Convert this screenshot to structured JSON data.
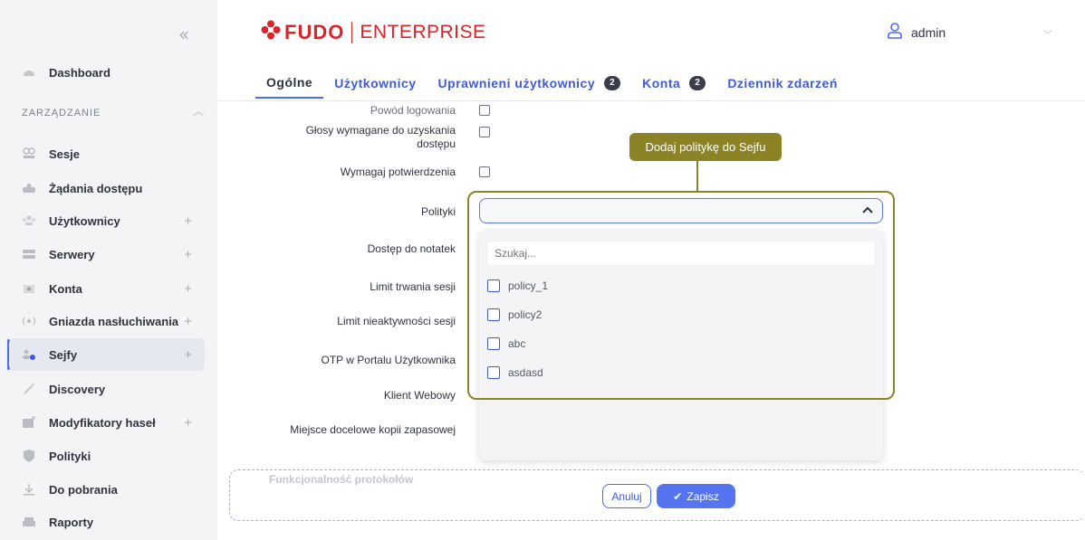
{
  "sidebar": {
    "collapse_icon": "double-chevron-left-icon",
    "dashboard": "Dashboard",
    "section": "ZARZĄDZANIE",
    "items": [
      {
        "label": "Sesje",
        "icon": "sessions-icon",
        "plus": false
      },
      {
        "label": "Żądania dostępu",
        "icon": "access-requests-icon",
        "plus": false
      },
      {
        "label": "Użytkownicy",
        "icon": "users-icon",
        "plus": true
      },
      {
        "label": "Serwery",
        "icon": "servers-icon",
        "plus": true
      },
      {
        "label": "Konta",
        "icon": "accounts-icon",
        "plus": true
      },
      {
        "label": "Gniazda nasłuchiwania",
        "icon": "listeners-icon",
        "plus": true
      },
      {
        "label": "Sejfy",
        "icon": "safes-icon",
        "plus": true,
        "active": true
      },
      {
        "label": "Discovery",
        "icon": "discovery-icon",
        "plus": false
      },
      {
        "label": "Modyfikatory haseł",
        "icon": "password-changers-icon",
        "plus": true
      },
      {
        "label": "Polityki",
        "icon": "shield-icon",
        "plus": false
      },
      {
        "label": "Do pobrania",
        "icon": "download-icon",
        "plus": false
      },
      {
        "label": "Raporty",
        "icon": "reports-icon",
        "plus": false
      }
    ],
    "plus_glyph": "+"
  },
  "header": {
    "logo_fudo": "FUDO",
    "logo_enterprise": "ENTERPRISE",
    "username": "admin",
    "brand_color": "#d7262b"
  },
  "tabs": [
    {
      "label": "Ogólne",
      "active": true
    },
    {
      "label": "Użytkownicy"
    },
    {
      "label": "Uprawnieni użytkownicy",
      "badge": "2"
    },
    {
      "label": "Konta",
      "badge": "2"
    },
    {
      "label": "Dziennik zdarzeń"
    }
  ],
  "form": {
    "reason_label": "Powód logowania",
    "votes_label_1": "Głosy wymagane do uzyskania",
    "votes_label_2": "dostępu",
    "confirm_label": "Wymagaj potwierdzenia",
    "policies_label": "Polityki",
    "notes_label": "Dostęp do notatek",
    "session_limit_label": "Limit trwania sesji",
    "inactivity_label": "Limit nieaktywności sesji",
    "otp_label": "OTP w Portalu Użytkownika",
    "web_client_label": "Klient Webowy",
    "backup_label": "Miejsce docelowe kopii zapasowej"
  },
  "dropdown": {
    "search_placeholder": "Szukaj...",
    "options": [
      "policy_1",
      "policy2",
      "abc",
      "asdasd"
    ]
  },
  "tooltip": {
    "text": "Dodaj politykę do Sejfu",
    "color": "#8c8327"
  },
  "footer": {
    "ghost_text": "Funkcjonalność protokołów",
    "cancel": "Anuluj",
    "save": "Zapisz",
    "accent": "#4a6cf7"
  }
}
